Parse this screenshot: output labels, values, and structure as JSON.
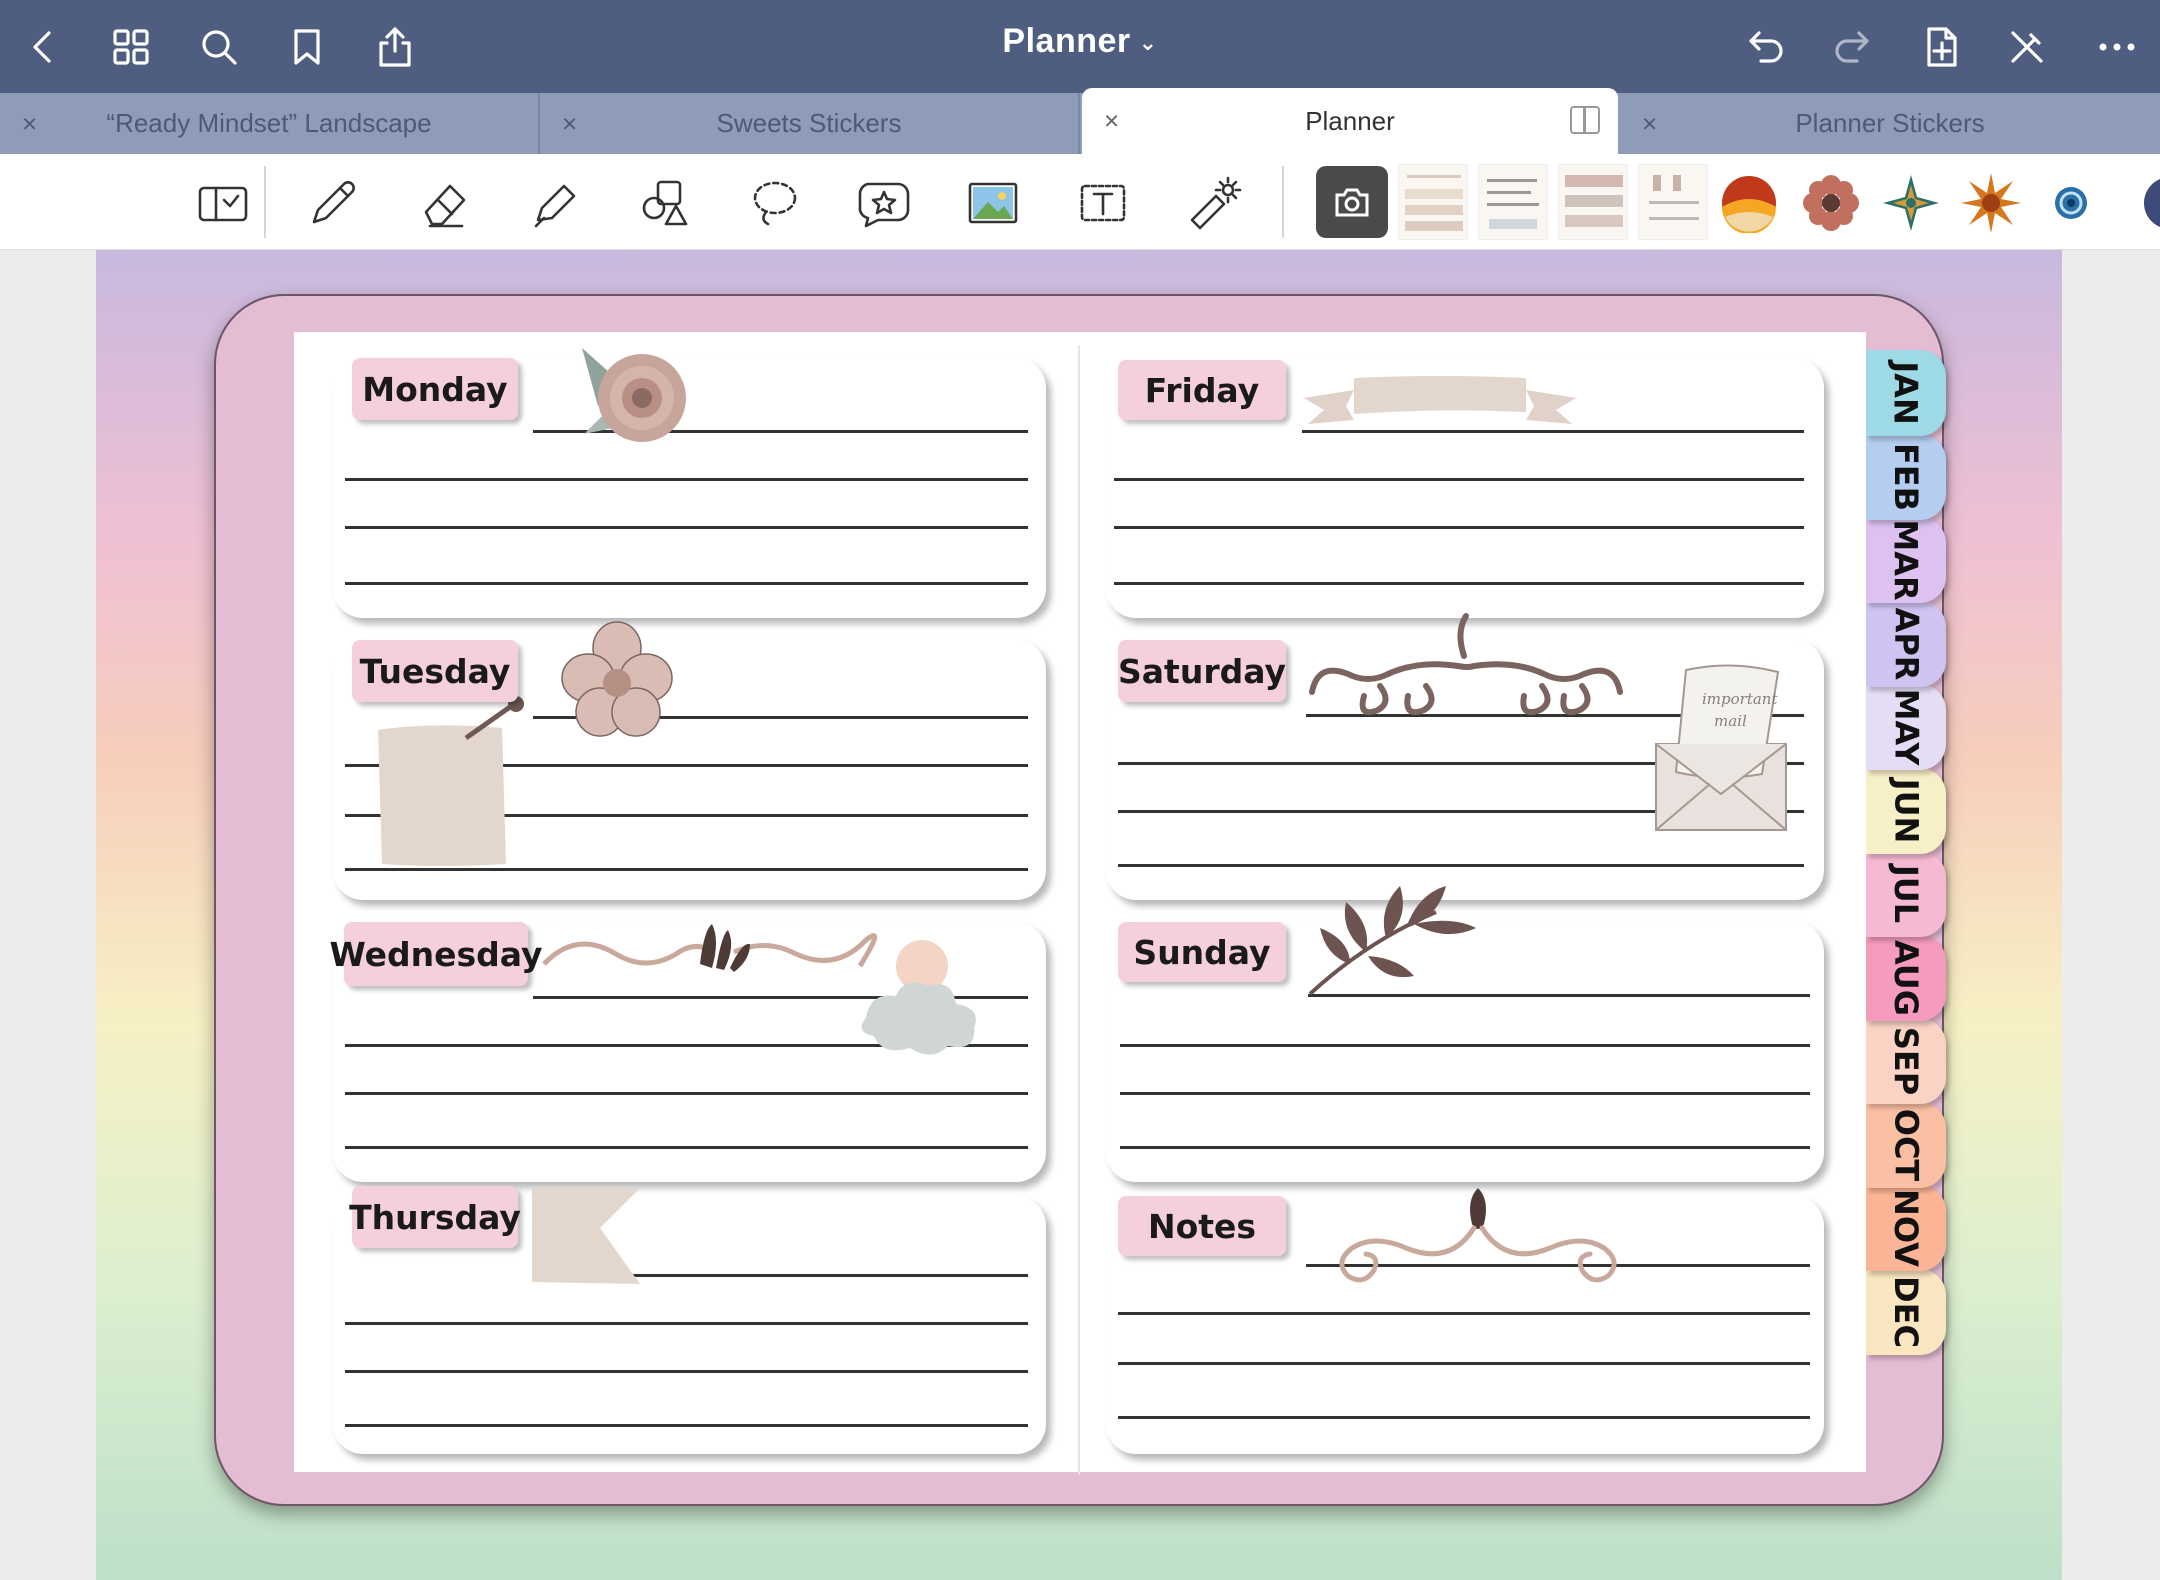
{
  "app": {
    "title": "Planner",
    "tabs": [
      {
        "label": "“Ready Mindset” Landscape",
        "active": false
      },
      {
        "label": "Sweets Stickers",
        "active": false
      },
      {
        "label": "Planner",
        "active": true
      },
      {
        "label": "Planner Stickers",
        "active": false
      }
    ],
    "tab_close": "×"
  },
  "planner": {
    "days_left": [
      "Monday",
      "Tuesday",
      "Wednesday",
      "Thursday"
    ],
    "days_right": [
      "Friday",
      "Saturday",
      "Sunday",
      "Notes"
    ],
    "envelope_note": "important mail",
    "months": [
      {
        "label": "JAN",
        "color": "#9ed9e6"
      },
      {
        "label": "FEB",
        "color": "#b5cdf1"
      },
      {
        "label": "MAR",
        "color": "#dcc1f1"
      },
      {
        "label": "APR",
        "color": "#cfc3f2"
      },
      {
        "label": "MAY",
        "color": "#e5ddf6"
      },
      {
        "label": "JUN",
        "color": "#f7efc6"
      },
      {
        "label": "JUL",
        "color": "#f6b9d3"
      },
      {
        "label": "AUG",
        "color": "#f59bbd"
      },
      {
        "label": "SEP",
        "color": "#fad3c4"
      },
      {
        "label": "OCT",
        "color": "#fbbfa3"
      },
      {
        "label": "NOV",
        "color": "#fbb596"
      },
      {
        "label": "DEC",
        "color": "#f9e6c0"
      }
    ]
  },
  "colors": {
    "topbar": "#4e5d80",
    "tabbar": "#8e9cba",
    "cover": "#e4bcd3",
    "label": "#f6cfdc"
  }
}
